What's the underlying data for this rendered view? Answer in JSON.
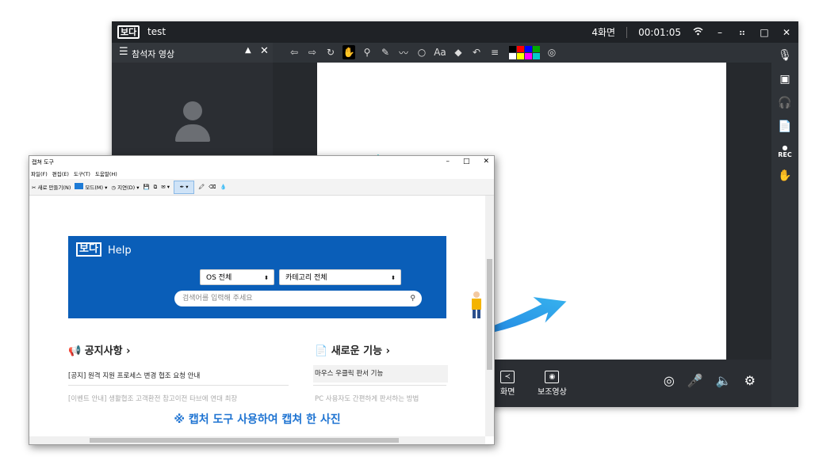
{
  "app": {
    "logo": "보다",
    "title": "test",
    "layout_label": "4화면",
    "timer": "00:01:05",
    "participant_panel_label": "참석자 영상"
  },
  "palette_colors": [
    "#000000",
    "#ff0000",
    "#0000ff",
    "#00aa00",
    "#ffffff",
    "#ffff00",
    "#ff00ff",
    "#00cccc"
  ],
  "bottom": {
    "screen_label": "화면",
    "sub_video_label": "보조영상"
  },
  "rightbar": {
    "rec_label": "REC"
  },
  "capture": {
    "window_title": "캡쳐 도구",
    "menu": [
      "파일(F)",
      "편집(E)",
      "도구(T)",
      "도움말(H)"
    ],
    "new_label": "새로 만들기(N)",
    "mode_label": "모드(M)",
    "delay_label": "지연(D)",
    "help_logo": "보다",
    "help_text": "Help",
    "os_select": "OS 전체",
    "category_select": "카테고리 전체",
    "search_placeholder": "검색어를 입력해 주세요",
    "notice_title": "공지사항 ›",
    "notice_item": "[공지] 원격 지원 프로세스 변경 협조 요청 안내",
    "notice_item2": "[이벤트 안내] 생활협조 고객환전 참고이전 타브에 연대 최장",
    "feature_title": "새로운 기능 ›",
    "feature_item": "마우스 우클릭 판서 기능",
    "feature_item2": "PC 사용자도 간편하게 판서하는 방법",
    "caption": "※ 캡처 도구 사용하여 캡쳐 한 사진"
  }
}
